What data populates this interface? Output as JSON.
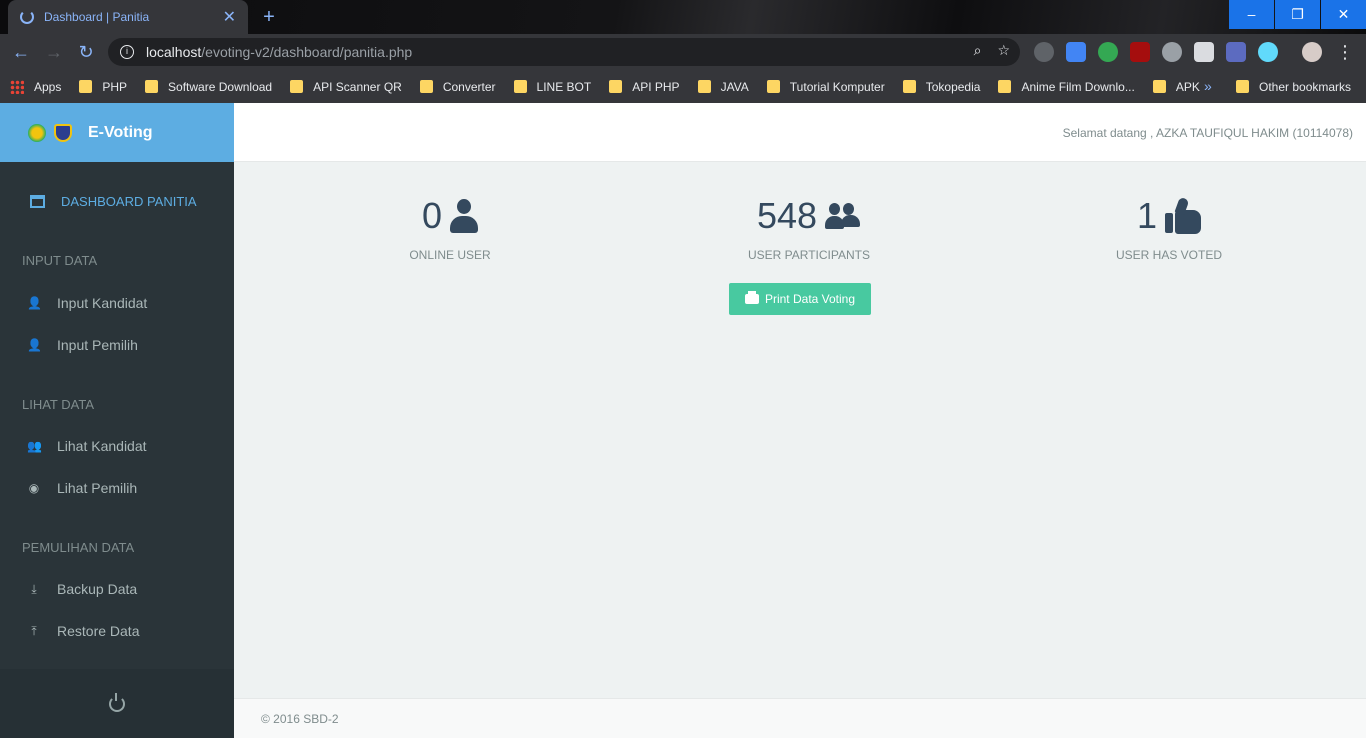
{
  "browser": {
    "tab_title": "Dashboard | Panitia",
    "url_host": "localhost",
    "url_path": "/evoting-v2/dashboard/panitia.php",
    "bookmarks": [
      "Apps",
      "PHP",
      "Software Download",
      "API Scanner QR",
      "Converter",
      "LINE BOT",
      "API PHP",
      "JAVA",
      "Tutorial Komputer",
      "Tokopedia",
      "Anime Film Downlo...",
      "APK"
    ],
    "other_bookmarks": "Other bookmarks",
    "more": "»"
  },
  "app": {
    "brand": "E-Voting",
    "welcome": "Selamat datang , AZKA TAUFIQUL HAKIM (10114078)"
  },
  "sidebar": {
    "active": "DASHBOARD PANITIA",
    "sections": [
      {
        "title": "INPUT DATA",
        "items": [
          "Input Kandidat",
          "Input Pemilih"
        ]
      },
      {
        "title": "LIHAT DATA",
        "items": [
          "Lihat Kandidat",
          "Lihat Pemilih"
        ]
      },
      {
        "title": "PEMULIHAN DATA",
        "items": [
          "Backup Data",
          "Restore Data"
        ]
      }
    ]
  },
  "stats": [
    {
      "value": "0",
      "label": "ONLINE USER",
      "icon": "user-icon"
    },
    {
      "value": "548",
      "label": "USER PARTICIPANTS",
      "icon": "users-icon"
    },
    {
      "value": "1",
      "label": "USER HAS VOTED",
      "icon": "thumbs-up-icon"
    }
  ],
  "print_button": "Print Data Voting",
  "footer": "© 2016 SBD-2",
  "colors": {
    "brand": "#5dade2",
    "sidebar": "#2a3439",
    "button": "#48c9a0"
  }
}
